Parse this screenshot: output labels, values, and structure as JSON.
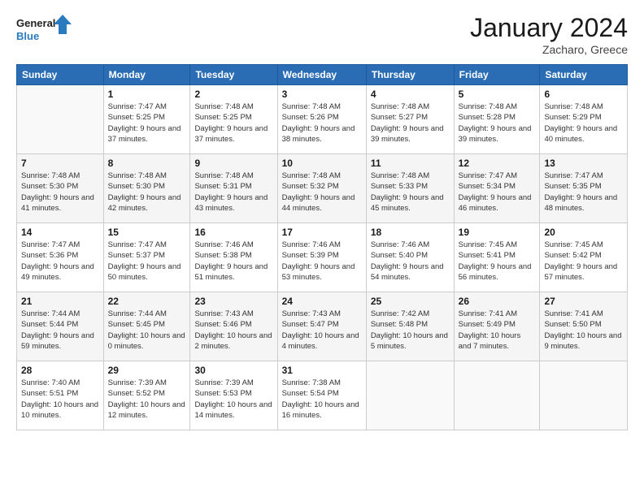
{
  "header": {
    "logo_line1": "General",
    "logo_line2": "Blue",
    "month": "January 2024",
    "location": "Zacharo, Greece"
  },
  "weekdays": [
    "Sunday",
    "Monday",
    "Tuesday",
    "Wednesday",
    "Thursday",
    "Friday",
    "Saturday"
  ],
  "weeks": [
    [
      {
        "day": "",
        "sunrise": "",
        "sunset": "",
        "daylight": ""
      },
      {
        "day": "1",
        "sunrise": "Sunrise: 7:47 AM",
        "sunset": "Sunset: 5:25 PM",
        "daylight": "Daylight: 9 hours and 37 minutes."
      },
      {
        "day": "2",
        "sunrise": "Sunrise: 7:48 AM",
        "sunset": "Sunset: 5:25 PM",
        "daylight": "Daylight: 9 hours and 37 minutes."
      },
      {
        "day": "3",
        "sunrise": "Sunrise: 7:48 AM",
        "sunset": "Sunset: 5:26 PM",
        "daylight": "Daylight: 9 hours and 38 minutes."
      },
      {
        "day": "4",
        "sunrise": "Sunrise: 7:48 AM",
        "sunset": "Sunset: 5:27 PM",
        "daylight": "Daylight: 9 hours and 39 minutes."
      },
      {
        "day": "5",
        "sunrise": "Sunrise: 7:48 AM",
        "sunset": "Sunset: 5:28 PM",
        "daylight": "Daylight: 9 hours and 39 minutes."
      },
      {
        "day": "6",
        "sunrise": "Sunrise: 7:48 AM",
        "sunset": "Sunset: 5:29 PM",
        "daylight": "Daylight: 9 hours and 40 minutes."
      }
    ],
    [
      {
        "day": "7",
        "sunrise": "Sunrise: 7:48 AM",
        "sunset": "Sunset: 5:30 PM",
        "daylight": "Daylight: 9 hours and 41 minutes."
      },
      {
        "day": "8",
        "sunrise": "Sunrise: 7:48 AM",
        "sunset": "Sunset: 5:30 PM",
        "daylight": "Daylight: 9 hours and 42 minutes."
      },
      {
        "day": "9",
        "sunrise": "Sunrise: 7:48 AM",
        "sunset": "Sunset: 5:31 PM",
        "daylight": "Daylight: 9 hours and 43 minutes."
      },
      {
        "day": "10",
        "sunrise": "Sunrise: 7:48 AM",
        "sunset": "Sunset: 5:32 PM",
        "daylight": "Daylight: 9 hours and 44 minutes."
      },
      {
        "day": "11",
        "sunrise": "Sunrise: 7:48 AM",
        "sunset": "Sunset: 5:33 PM",
        "daylight": "Daylight: 9 hours and 45 minutes."
      },
      {
        "day": "12",
        "sunrise": "Sunrise: 7:47 AM",
        "sunset": "Sunset: 5:34 PM",
        "daylight": "Daylight: 9 hours and 46 minutes."
      },
      {
        "day": "13",
        "sunrise": "Sunrise: 7:47 AM",
        "sunset": "Sunset: 5:35 PM",
        "daylight": "Daylight: 9 hours and 48 minutes."
      }
    ],
    [
      {
        "day": "14",
        "sunrise": "Sunrise: 7:47 AM",
        "sunset": "Sunset: 5:36 PM",
        "daylight": "Daylight: 9 hours and 49 minutes."
      },
      {
        "day": "15",
        "sunrise": "Sunrise: 7:47 AM",
        "sunset": "Sunset: 5:37 PM",
        "daylight": "Daylight: 9 hours and 50 minutes."
      },
      {
        "day": "16",
        "sunrise": "Sunrise: 7:46 AM",
        "sunset": "Sunset: 5:38 PM",
        "daylight": "Daylight: 9 hours and 51 minutes."
      },
      {
        "day": "17",
        "sunrise": "Sunrise: 7:46 AM",
        "sunset": "Sunset: 5:39 PM",
        "daylight": "Daylight: 9 hours and 53 minutes."
      },
      {
        "day": "18",
        "sunrise": "Sunrise: 7:46 AM",
        "sunset": "Sunset: 5:40 PM",
        "daylight": "Daylight: 9 hours and 54 minutes."
      },
      {
        "day": "19",
        "sunrise": "Sunrise: 7:45 AM",
        "sunset": "Sunset: 5:41 PM",
        "daylight": "Daylight: 9 hours and 56 minutes."
      },
      {
        "day": "20",
        "sunrise": "Sunrise: 7:45 AM",
        "sunset": "Sunset: 5:42 PM",
        "daylight": "Daylight: 9 hours and 57 minutes."
      }
    ],
    [
      {
        "day": "21",
        "sunrise": "Sunrise: 7:44 AM",
        "sunset": "Sunset: 5:44 PM",
        "daylight": "Daylight: 9 hours and 59 minutes."
      },
      {
        "day": "22",
        "sunrise": "Sunrise: 7:44 AM",
        "sunset": "Sunset: 5:45 PM",
        "daylight": "Daylight: 10 hours and 0 minutes."
      },
      {
        "day": "23",
        "sunrise": "Sunrise: 7:43 AM",
        "sunset": "Sunset: 5:46 PM",
        "daylight": "Daylight: 10 hours and 2 minutes."
      },
      {
        "day": "24",
        "sunrise": "Sunrise: 7:43 AM",
        "sunset": "Sunset: 5:47 PM",
        "daylight": "Daylight: 10 hours and 4 minutes."
      },
      {
        "day": "25",
        "sunrise": "Sunrise: 7:42 AM",
        "sunset": "Sunset: 5:48 PM",
        "daylight": "Daylight: 10 hours and 5 minutes."
      },
      {
        "day": "26",
        "sunrise": "Sunrise: 7:41 AM",
        "sunset": "Sunset: 5:49 PM",
        "daylight": "Daylight: 10 hours and 7 minutes."
      },
      {
        "day": "27",
        "sunrise": "Sunrise: 7:41 AM",
        "sunset": "Sunset: 5:50 PM",
        "daylight": "Daylight: 10 hours and 9 minutes."
      }
    ],
    [
      {
        "day": "28",
        "sunrise": "Sunrise: 7:40 AM",
        "sunset": "Sunset: 5:51 PM",
        "daylight": "Daylight: 10 hours and 10 minutes."
      },
      {
        "day": "29",
        "sunrise": "Sunrise: 7:39 AM",
        "sunset": "Sunset: 5:52 PM",
        "daylight": "Daylight: 10 hours and 12 minutes."
      },
      {
        "day": "30",
        "sunrise": "Sunrise: 7:39 AM",
        "sunset": "Sunset: 5:53 PM",
        "daylight": "Daylight: 10 hours and 14 minutes."
      },
      {
        "day": "31",
        "sunrise": "Sunrise: 7:38 AM",
        "sunset": "Sunset: 5:54 PM",
        "daylight": "Daylight: 10 hours and 16 minutes."
      },
      {
        "day": "",
        "sunrise": "",
        "sunset": "",
        "daylight": ""
      },
      {
        "day": "",
        "sunrise": "",
        "sunset": "",
        "daylight": ""
      },
      {
        "day": "",
        "sunrise": "",
        "sunset": "",
        "daylight": ""
      }
    ]
  ]
}
